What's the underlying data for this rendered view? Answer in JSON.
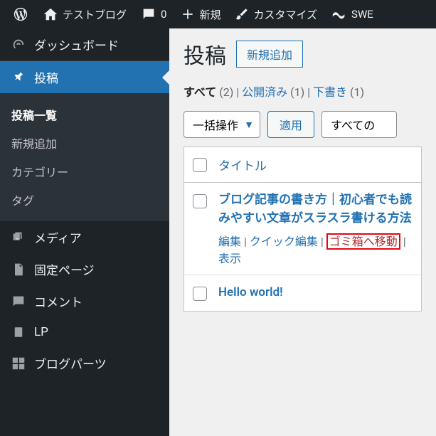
{
  "adminbar": {
    "site_name": "テストブログ",
    "comments_count": "0",
    "new_label": "新規",
    "customize_label": "カスタマイズ",
    "swe_label": "SWE"
  },
  "sidebar": {
    "dashboard": "ダッシュボード",
    "posts": "投稿",
    "posts_submenu": {
      "all_posts": "投稿一覧",
      "add_new": "新規追加",
      "categories": "カテゴリー",
      "tags": "タグ"
    },
    "media": "メディア",
    "pages": "固定ページ",
    "comments": "コメント",
    "lp": "LP",
    "blog_parts": "ブログパーツ"
  },
  "main": {
    "page_title": "投稿",
    "add_new": "新規追加",
    "filters": {
      "all": "すべて",
      "all_count": "(2)",
      "published": "公開済み",
      "published_count": "(1)",
      "draft": "下書き",
      "draft_count": "(1)",
      "sep": " | "
    },
    "bulk_action": "一括操作",
    "apply": "適用",
    "all_categories": "すべての",
    "table": {
      "title_header": "タイトル",
      "rows": [
        {
          "title": "ブログ記事の書き方｜初心者でも読みやすい文章がスラスラ書ける方法",
          "actions": {
            "edit": "編集",
            "quick_edit": "クイック編集",
            "trash": "ゴミ箱へ移動",
            "view": "表示"
          }
        },
        {
          "title": "Hello world!"
        }
      ]
    }
  }
}
